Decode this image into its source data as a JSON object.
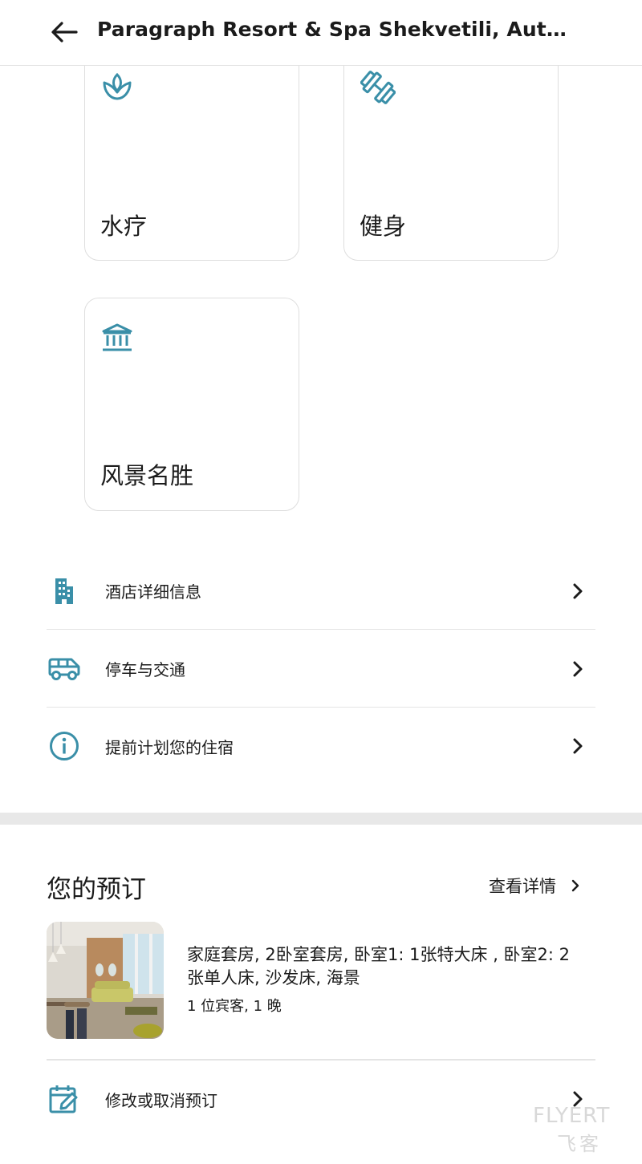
{
  "header": {
    "title": "Paragraph Resort & Spa Shekvetili, Autogra…"
  },
  "amenities": [
    {
      "label": "水疗",
      "icon": "spa-lotus-icon"
    },
    {
      "label": "健身",
      "icon": "dumbbell-icon"
    },
    {
      "label": "风景名胜",
      "icon": "landmark-icon"
    }
  ],
  "info_rows": [
    {
      "label": "酒店详细信息",
      "icon": "building-icon"
    },
    {
      "label": "停车与交通",
      "icon": "van-icon"
    },
    {
      "label": "提前计划您的住宿",
      "icon": "info-icon"
    }
  ],
  "reservation": {
    "title": "您的预订",
    "view_details": "查看详情",
    "room_description": "家庭套房, 2卧室套房, 卧室1: 1张特大床 , 卧室2: 2张单人床, 沙发床, 海景",
    "guests_nights": "1 位宾客, 1 晚",
    "modify_label": "修改或取消预订"
  },
  "watermark": {
    "line1": "FLYERT",
    "line2": "飞客"
  },
  "colors": {
    "accent_teal": "#3a8fa8",
    "text": "#1b1b1b",
    "border": "#dedede"
  }
}
